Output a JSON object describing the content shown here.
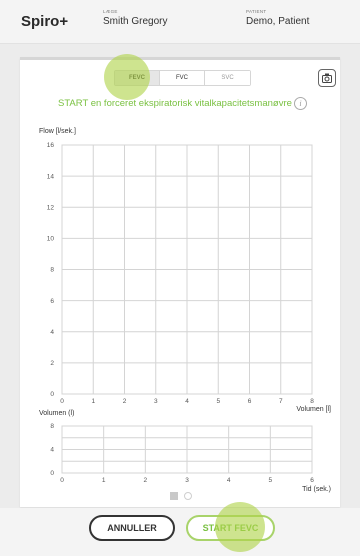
{
  "header": {
    "app_name": "Spiro+",
    "doctor_label": "LÆGE",
    "doctor_name": "Smith Gregory",
    "patient_label": "PATIENT",
    "patient_name": "Demo, Patient"
  },
  "mode_tabs": [
    {
      "label": "FEVC",
      "active": true
    },
    {
      "label": "FVC",
      "active": false
    },
    {
      "label": "SVC",
      "active": false
    }
  ],
  "instruction": "START en forceret ekspiratorisk vitalkapacitetsmanøvre",
  "info_symbol": "i",
  "icons": {
    "camera": "camera-icon",
    "info": "info-icon"
  },
  "chart_data": [
    {
      "type": "line",
      "ylabel": "Flow [l/sek.]",
      "xlabel": "Volumen [l]",
      "x_ticks": [
        "0",
        "1",
        "2",
        "3",
        "4",
        "5",
        "6",
        "7",
        "8"
      ],
      "y_ticks": [
        "0",
        "2",
        "4",
        "6",
        "8",
        "10",
        "12",
        "14",
        "16"
      ],
      "xlim": [
        0,
        8
      ],
      "ylim": [
        0,
        16
      ],
      "grid": true,
      "series": []
    },
    {
      "type": "line",
      "ylabel": "Volumen (l)",
      "xlabel": "Tid (sek.)",
      "x_ticks": [
        "0",
        "1",
        "2",
        "3",
        "4",
        "5",
        "6"
      ],
      "y_ticks": [
        "0",
        "4",
        "8"
      ],
      "xlim": [
        0,
        6
      ],
      "ylim": [
        0,
        8
      ],
      "grid": true,
      "series": []
    }
  ],
  "pager": {
    "pages": 2,
    "current": 1
  },
  "buttons": {
    "cancel": "ANNULLER",
    "start": "START FEVC"
  },
  "colors": {
    "accent_green": "#7ac142",
    "touch_highlight": "#b0d44a",
    "grid": "#d4d4d4"
  }
}
